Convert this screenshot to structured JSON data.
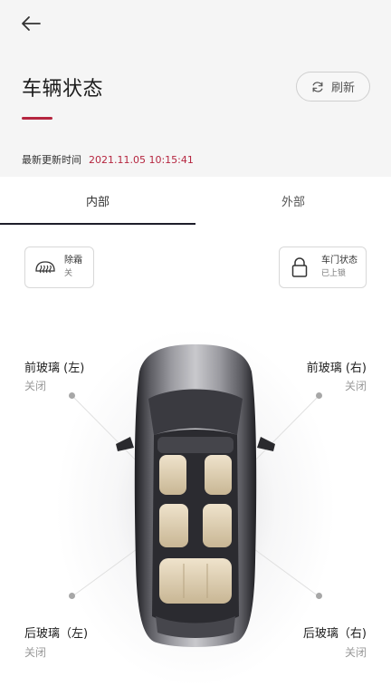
{
  "header": {
    "back_icon": "arrow-left-icon",
    "title": "车辆状态",
    "refresh_label": "刷新",
    "refresh_icon": "refresh-icon",
    "update_label": "最新更新时间",
    "update_time": "2021.11.05 10:15:41",
    "accent_color": "#b5253f"
  },
  "tabs": [
    {
      "label": "内部",
      "active": true
    },
    {
      "label": "外部",
      "active": false
    }
  ],
  "cards": {
    "defrost": {
      "icon": "rear-defrost-icon",
      "title": "除霜",
      "status": "关"
    },
    "door": {
      "icon": "lock-icon",
      "title": "车门状态",
      "status": "已上锁"
    }
  },
  "windows": {
    "front_left": {
      "label": "前玻璃 (左)",
      "status": "关闭"
    },
    "front_right": {
      "label": "前玻璃 (右)",
      "status": "关闭"
    },
    "rear_left": {
      "label": "后玻璃（左)",
      "status": "关闭"
    },
    "rear_right": {
      "label": "后玻璃（右)",
      "status": "关闭"
    }
  },
  "car_image": "car-top-view"
}
